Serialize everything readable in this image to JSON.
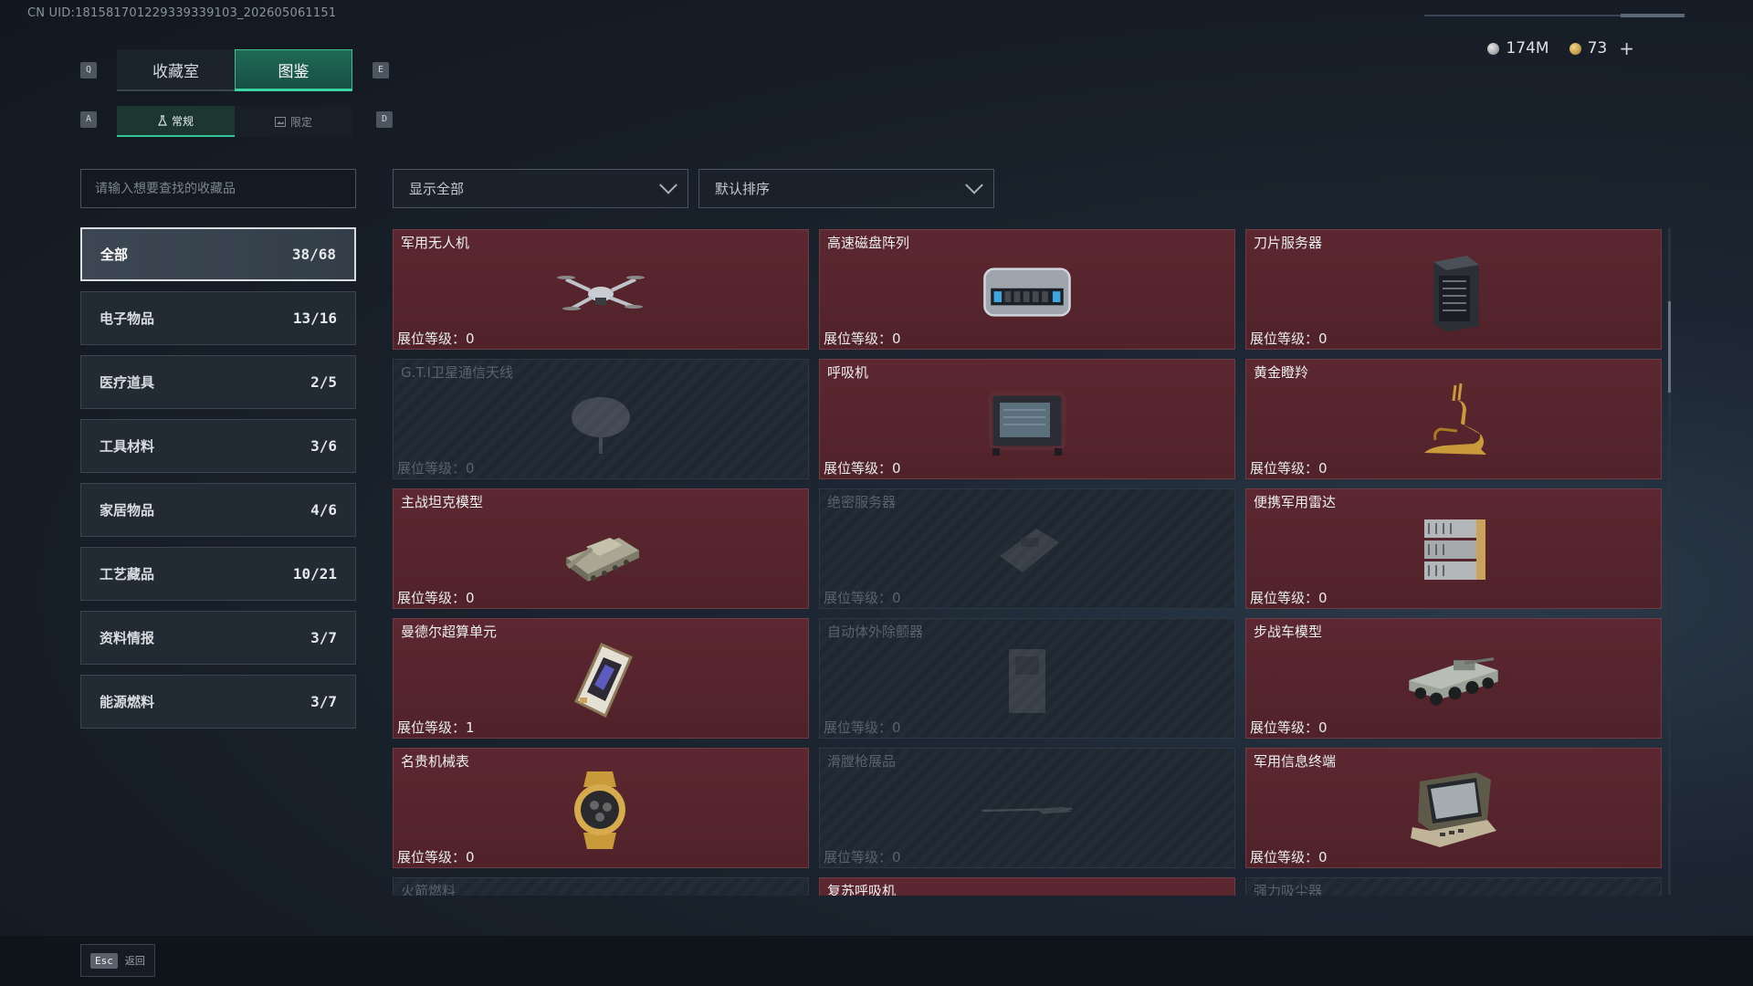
{
  "uid": "CN UID:181581701229339339103_202605061151",
  "currency": [
    {
      "icon": "silver-coin-icon",
      "value": "174M"
    },
    {
      "icon": "gold-coin-icon",
      "value": "73"
    }
  ],
  "keys": {
    "prev_tab": "Q",
    "next_tab": "E",
    "prev_sub": "A",
    "next_sub": "D"
  },
  "tabs": [
    {
      "label": "收藏室",
      "active": false
    },
    {
      "label": "图鉴",
      "active": true
    }
  ],
  "subtabs": [
    {
      "label": "常规",
      "icon": "flask-icon",
      "active": true
    },
    {
      "label": "限定",
      "icon": "image-icon",
      "active": false
    }
  ],
  "search": {
    "placeholder": "请输入想要查找的收藏品"
  },
  "filters": {
    "show": "显示全部",
    "sort": "默认排序"
  },
  "categories": [
    {
      "label": "全部",
      "count": "38/68"
    },
    {
      "label": "电子物品",
      "count": "13/16"
    },
    {
      "label": "医疗道具",
      "count": "2/5"
    },
    {
      "label": "工具材料",
      "count": "3/6"
    },
    {
      "label": "家居物品",
      "count": "4/6"
    },
    {
      "label": "工艺藏品",
      "count": "10/21"
    },
    {
      "label": "资料情报",
      "count": "3/7"
    },
    {
      "label": "能源燃料",
      "count": "3/7"
    }
  ],
  "level_label": "展位等级：",
  "items": [
    {
      "name": "军用无人机",
      "level": "0",
      "icon": "drone-icon",
      "owned": true
    },
    {
      "name": "高速磁盘阵列",
      "level": "0",
      "icon": "disk-array-icon",
      "owned": true
    },
    {
      "name": "刀片服务器",
      "level": "0",
      "icon": "server-icon",
      "owned": true
    },
    {
      "name": "G.T.I卫星通信天线",
      "level": "0",
      "icon": "satellite-dish-icon",
      "owned": false
    },
    {
      "name": "呼吸机",
      "level": "0",
      "icon": "ventilator-icon",
      "owned": true
    },
    {
      "name": "黄金瞪羚",
      "level": "0",
      "icon": "gazelle-icon",
      "owned": true
    },
    {
      "name": "主战坦克模型",
      "level": "0",
      "icon": "tank-icon",
      "owned": true
    },
    {
      "name": "绝密服务器",
      "level": "0",
      "icon": "secret-server-icon",
      "owned": false
    },
    {
      "name": "便携军用雷达",
      "level": "0",
      "icon": "radar-icon",
      "owned": true
    },
    {
      "name": "曼德尔超算单元",
      "level": "1",
      "icon": "cpu-icon",
      "owned": true
    },
    {
      "name": "自动体外除颤器",
      "level": "0",
      "icon": "defibrillator-icon",
      "owned": false
    },
    {
      "name": "步战车模型",
      "level": "0",
      "icon": "ifv-icon",
      "owned": true
    },
    {
      "name": "名贵机械表",
      "level": "0",
      "icon": "watch-icon",
      "owned": true
    },
    {
      "name": "滑膛枪展品",
      "level": "0",
      "icon": "musket-icon",
      "owned": false
    },
    {
      "name": "军用信息终端",
      "level": "0",
      "icon": "terminal-icon",
      "owned": true
    },
    {
      "name": "火箭燃料",
      "level": "",
      "icon": "",
      "owned": false
    },
    {
      "name": "复苏呼吸机",
      "level": "",
      "icon": "",
      "owned": true
    },
    {
      "name": "强力吸尘器",
      "level": "",
      "icon": "",
      "owned": false
    }
  ],
  "footer": {
    "esc_key": "Esc",
    "back_label": "返回"
  }
}
